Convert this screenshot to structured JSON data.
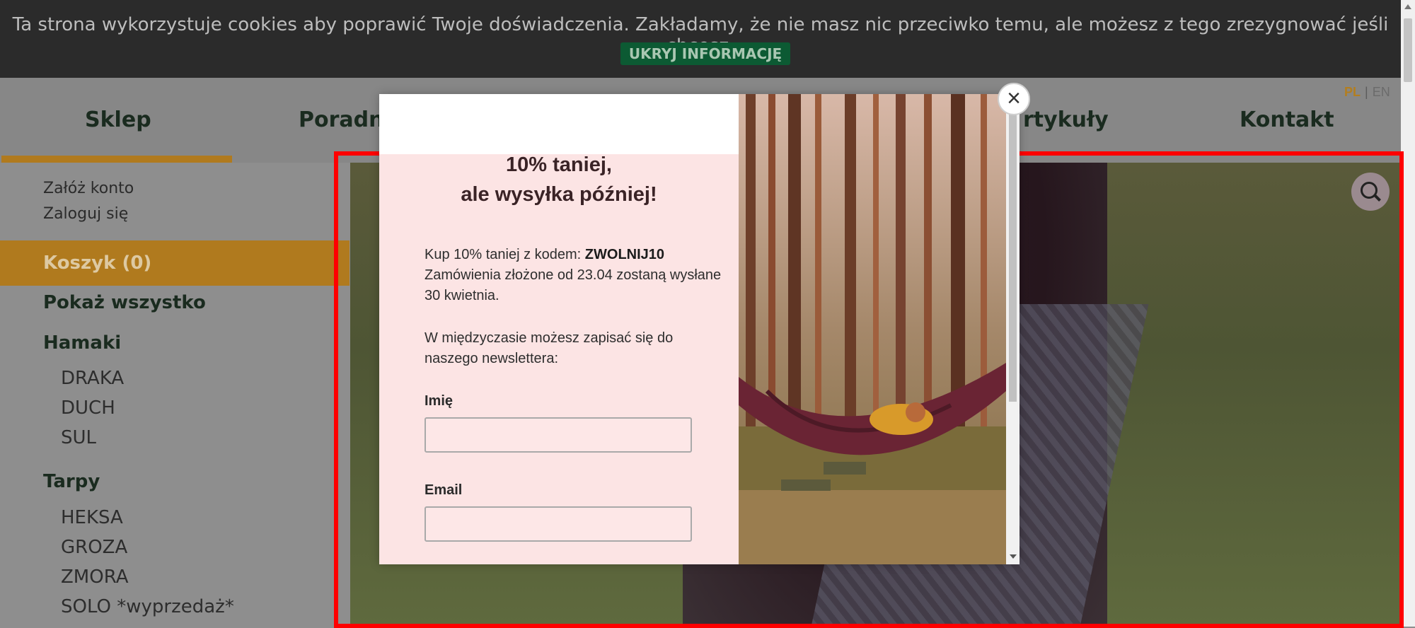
{
  "cookie": {
    "text": "Ta strona wykorzystuje cookies aby poprawić Twoje doświadczenia. Zakładamy, że nie masz nic przeciwko temu, ale możesz z tego zrezygnować jeśli chcesz.",
    "button": "UKRYJ INFORMACJĘ"
  },
  "lang": {
    "pl": "PL",
    "sep": "|",
    "en": "EN"
  },
  "nav": {
    "items": [
      "Sklep",
      "Poradn",
      "rtykuły",
      "Kontakt"
    ],
    "active_color": "#b07a1e"
  },
  "sidebar": {
    "account": [
      "Załóż konto",
      "Zaloguj się"
    ],
    "cart": "Koszyk (0)",
    "show_all": "Pokaż wszystko",
    "categories": [
      {
        "name": "Hamaki",
        "items": [
          "DRAKA",
          "DUCH",
          "SUL"
        ]
      },
      {
        "name": "Tarpy",
        "items": [
          "HEKSA",
          "GROZA",
          "ZMORA",
          "SOLO *wyprzedaż*"
        ]
      }
    ]
  },
  "modal": {
    "title_line1": "10% taniej,",
    "title_line2": "ale wysyłka później!",
    "promo_prefix": "Kup 10% taniej z kodem: ",
    "promo_code": "ZWOLNIJ10",
    "promo_rest": "Zamówienia złożone od 23.04 zostaną wysłane 30 kwietnia.",
    "newsletter": "W międzyczasie możesz zapisać się do naszego newslettera:",
    "name_label": "Imię",
    "email_label": "Email",
    "close": "×"
  },
  "icons": {
    "zoom": "search-icon",
    "close": "close-icon"
  }
}
